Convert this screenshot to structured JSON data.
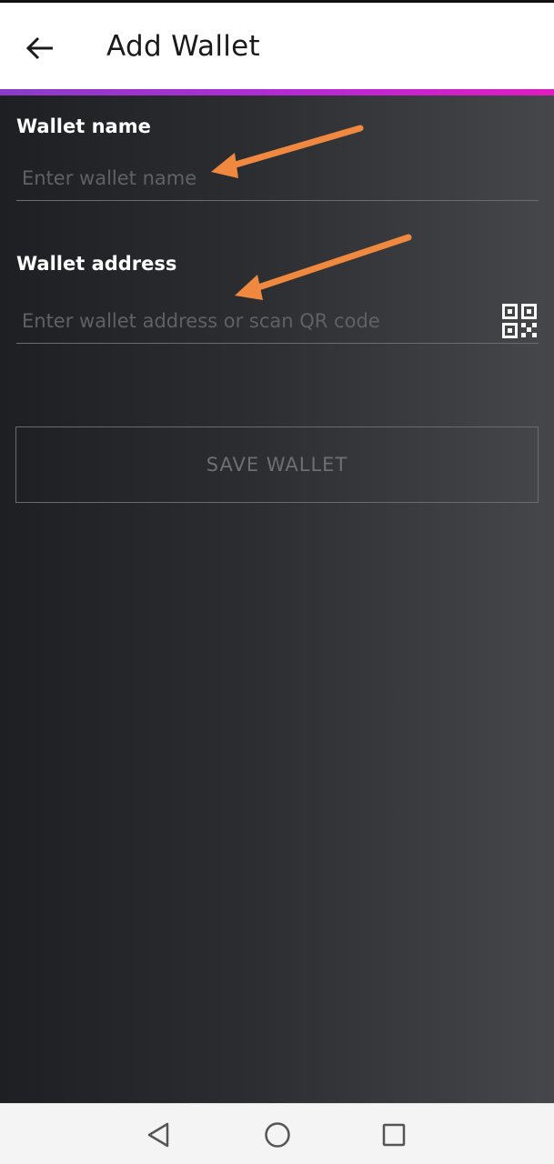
{
  "header": {
    "title": "Add Wallet",
    "back_icon": "arrow-left-icon"
  },
  "form": {
    "wallet_name": {
      "label": "Wallet name",
      "placeholder": "Enter wallet name",
      "value": ""
    },
    "wallet_address": {
      "label": "Wallet address",
      "placeholder": "Enter wallet address or scan QR code",
      "value": "",
      "scan_icon": "qr-code-icon"
    },
    "save_label": "SAVE WALLET"
  },
  "annotations": {
    "arrow_color": "#f0893f"
  },
  "navbar": {
    "back_icon": "triangle-back-icon",
    "home_icon": "circle-home-icon",
    "recents_icon": "square-recents-icon"
  },
  "colors": {
    "accent_start": "#8a3cc7",
    "accent_end": "#e21bc2",
    "background_dark": "#1d1f22",
    "background_light": "#46474b"
  }
}
